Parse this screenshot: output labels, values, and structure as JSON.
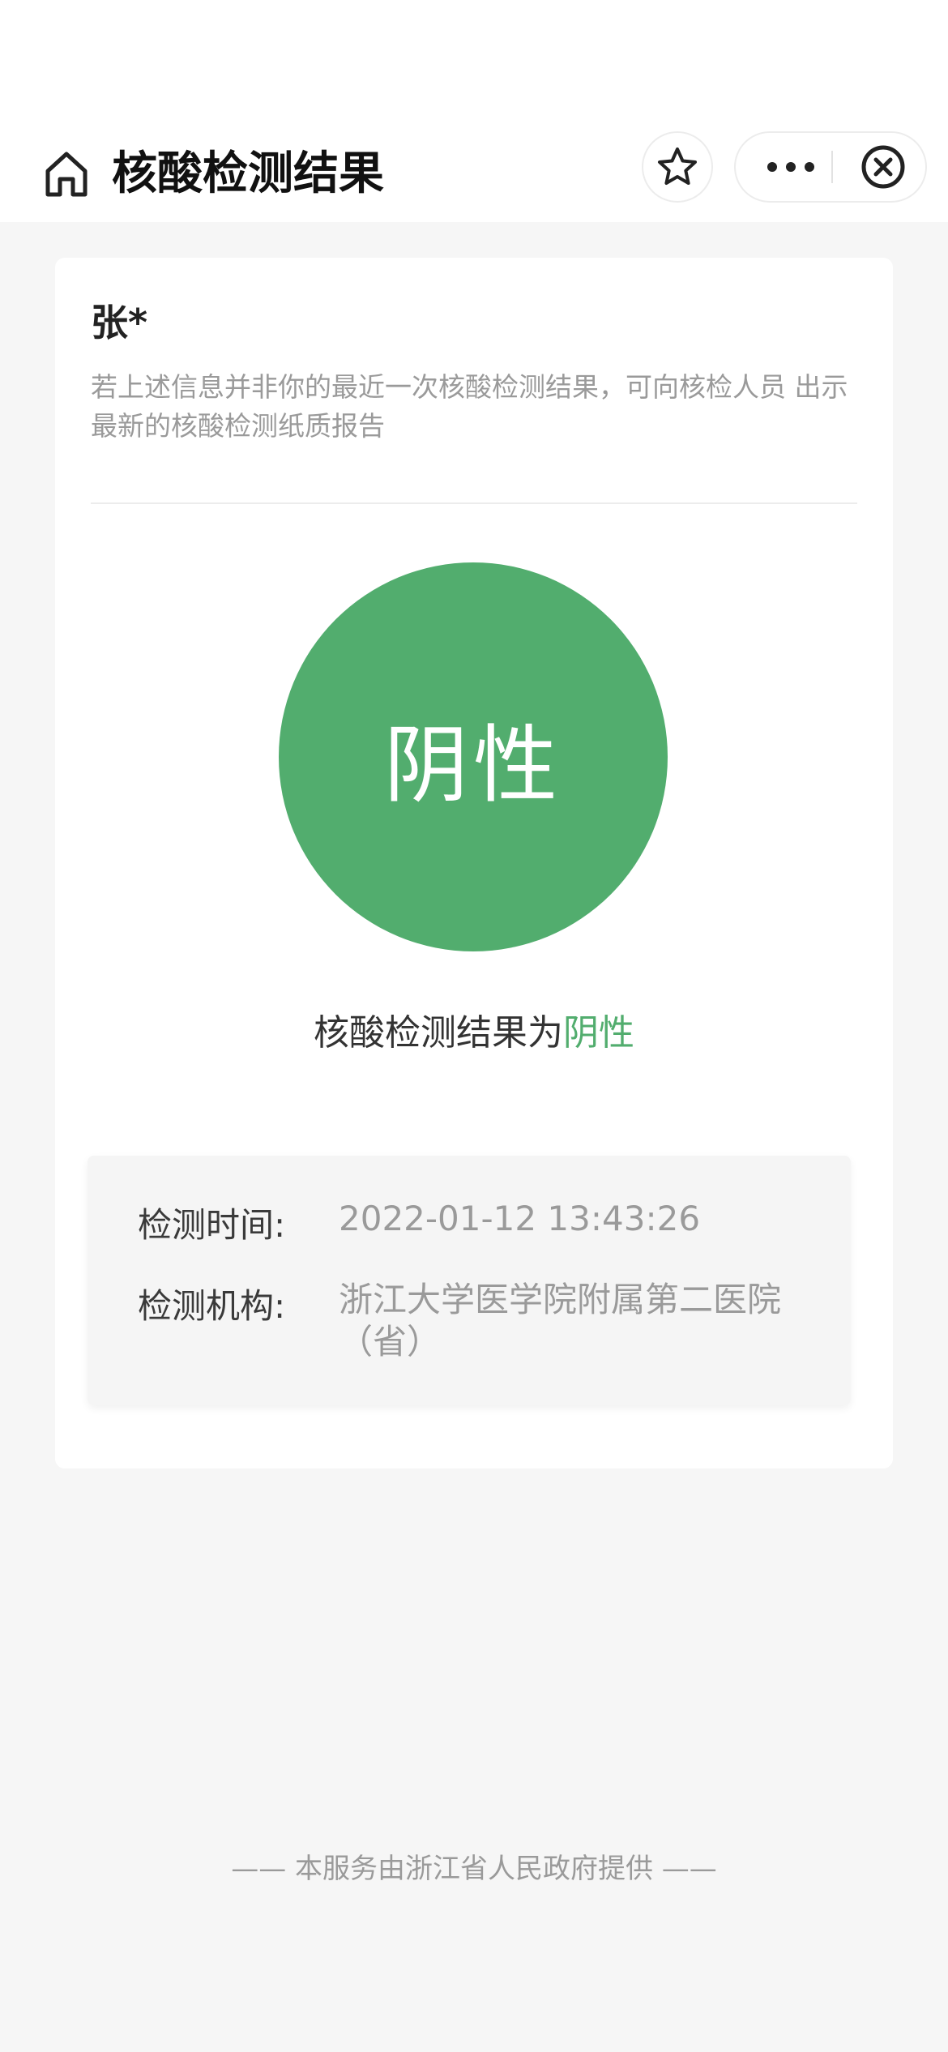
{
  "nav": {
    "title": "核酸检测结果",
    "home_icon": "home-icon",
    "star_icon": "star-icon",
    "more_icon": "more-dots-icon",
    "close_icon": "close-circle-icon"
  },
  "card": {
    "name": "张*",
    "notice": "若上述信息并非你的最近一次核酸检测结果，可向核检人员 出示最新的核酸检测纸质报告",
    "circle_text": "阴性",
    "result_prefix": "核酸检测结果为",
    "result_value": "阴性",
    "details": {
      "time_label": "检测时间:",
      "time_value": "2022-01-12 13:43:26",
      "org_label": "检测机构:",
      "org_value": "浙江大学医学院附属第二医院（省）"
    }
  },
  "footer": "—— 本服务由浙江省人民政府提供 ——",
  "colors": {
    "accent_green": "#52ad6e",
    "page_bg": "#f6f6f6"
  }
}
